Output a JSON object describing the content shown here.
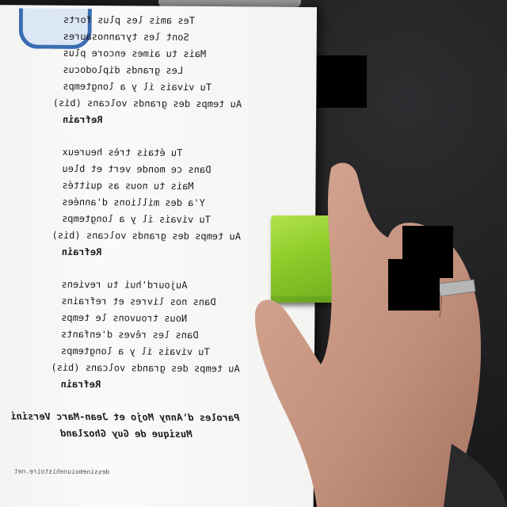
{
  "lyrics": [
    {
      "text": "Tes amis les plus forts",
      "style": "normal"
    },
    {
      "text": "Sont les tyrannosaures",
      "style": "normal"
    },
    {
      "text": "Mais tu aimes encore plus",
      "style": "normal"
    },
    {
      "text": "Les grands diplodocus",
      "style": "normal"
    },
    {
      "text": "Tu vivais il y a longtemps",
      "style": "normal"
    },
    {
      "text": "Au temps des grands volcans (bis)",
      "style": "normal"
    },
    {
      "text": "Refrain",
      "style": "refrain"
    },
    {
      "text": "",
      "style": "gap"
    },
    {
      "text": "Tu étais très heureux",
      "style": "normal"
    },
    {
      "text": "Dans ce monde vert et bleu",
      "style": "normal"
    },
    {
      "text": "Mais tu nous as quittés",
      "style": "normal"
    },
    {
      "text": "Y'a des millions d'années",
      "style": "normal"
    },
    {
      "text": "Tu vivais il y a longtemps",
      "style": "normal"
    },
    {
      "text": "Au temps des grands volcans (bis)",
      "style": "normal"
    },
    {
      "text": "Refrain",
      "style": "refrain"
    },
    {
      "text": "",
      "style": "gap"
    },
    {
      "text": "Aujourd'hui tu reviens",
      "style": "normal"
    },
    {
      "text": "Dans nos livres et refrains",
      "style": "normal"
    },
    {
      "text": "Nous trouvons le temps",
      "style": "normal"
    },
    {
      "text": "Dans les rêves d'enfants",
      "style": "normal"
    },
    {
      "text": "Tu vivais il y a longtemps",
      "style": "normal"
    },
    {
      "text": "Au temps des grands volcans (bis)",
      "style": "normal"
    },
    {
      "text": "Refrain",
      "style": "refrain"
    },
    {
      "text": "",
      "style": "gap"
    },
    {
      "text": "Paroles d'Anny Mojo et Jean-Marc Versini",
      "style": "credits"
    },
    {
      "text": "Musique de Guy Ghozland",
      "style": "credits"
    }
  ],
  "site_text": "dessinemoiunehistoire.net",
  "colors": {
    "paper": "#f6f6f4",
    "cube": "#9ed63a",
    "leaf": "#4ea84a",
    "skin": "#c99a86",
    "desk": "#1d1d1f"
  }
}
